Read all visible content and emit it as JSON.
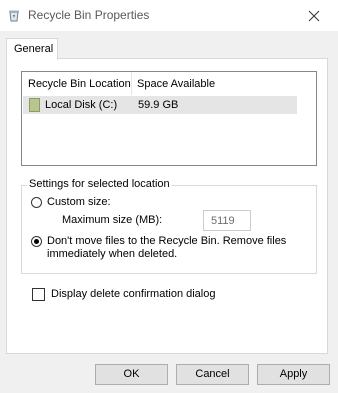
{
  "window": {
    "title": "Recycle Bin Properties",
    "icon": "recycle-bin-icon",
    "close_icon": "close-icon"
  },
  "tabs": [
    {
      "label": "General",
      "selected": true
    }
  ],
  "list": {
    "columns": [
      "Recycle Bin Location",
      "Space Available"
    ],
    "rows": [
      {
        "icon": "drive-icon",
        "location": "Local Disk (C:)",
        "space": "59.9 GB",
        "selected": true
      }
    ]
  },
  "settings": {
    "group_label": "Settings for selected location",
    "custom_size_label": "Custom size:",
    "custom_size_checked": false,
    "max_size_label": "Maximum size (MB):",
    "max_size_value": "5119",
    "dont_move_label": "Don't move files to the Recycle Bin. Remove files immediately when deleted.",
    "dont_move_checked": true
  },
  "confirm": {
    "label": "Display delete confirmation dialog",
    "checked": false
  },
  "buttons": {
    "ok": "OK",
    "cancel": "Cancel",
    "apply": "Apply"
  }
}
